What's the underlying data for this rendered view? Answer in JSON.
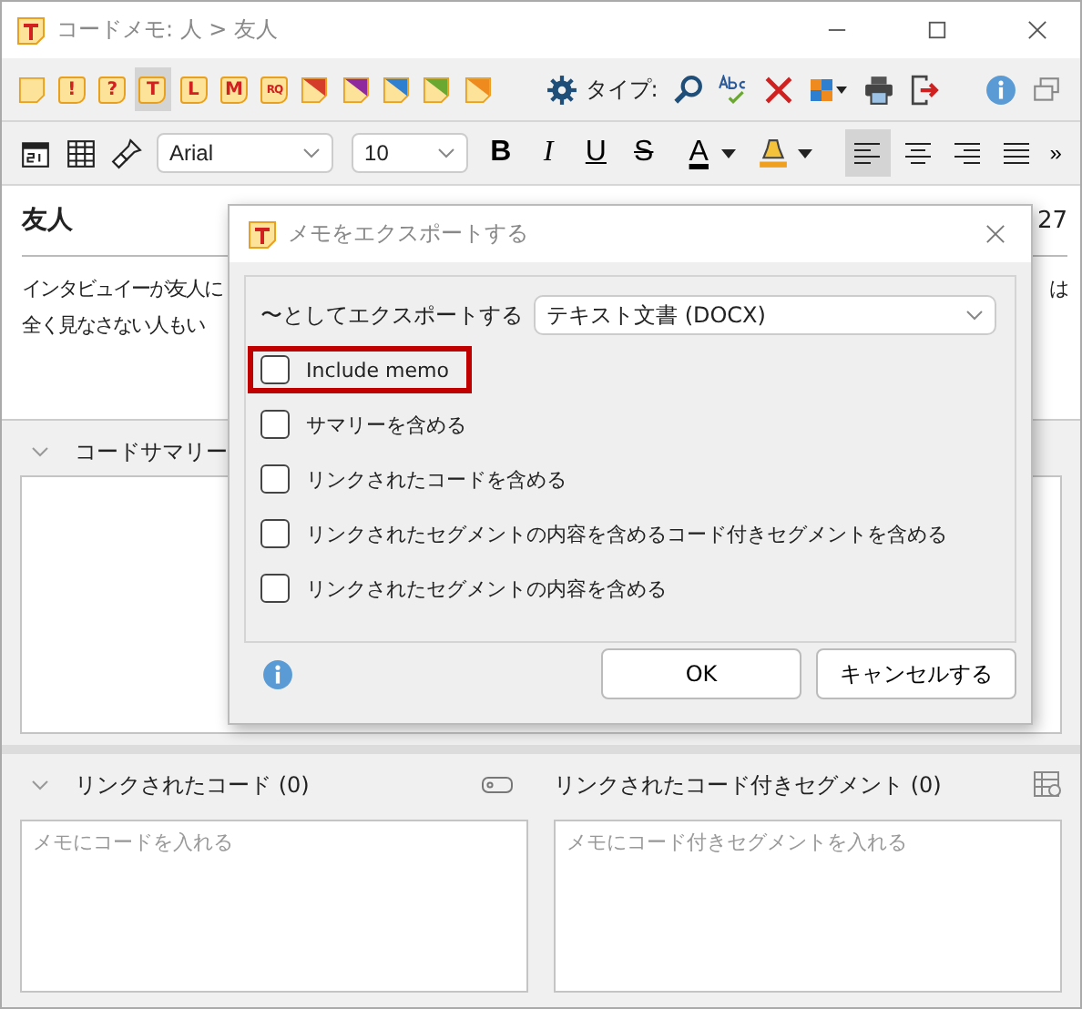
{
  "window": {
    "title": "コードメモ: 人 > 友人"
  },
  "memo_types": [
    {
      "kind": "blank",
      "selected": false
    },
    {
      "kind": "letter",
      "label": "!",
      "selected": false
    },
    {
      "kind": "letter",
      "label": "?",
      "selected": false
    },
    {
      "kind": "letter",
      "label": "T",
      "selected": true
    },
    {
      "kind": "letter",
      "label": "L",
      "selected": false
    },
    {
      "kind": "letter",
      "label": "M",
      "selected": false
    },
    {
      "kind": "letter",
      "label": "RQ",
      "selected": false
    },
    {
      "kind": "color",
      "color": "#d63c2a",
      "selected": false
    },
    {
      "kind": "color",
      "color": "#8e2a9e",
      "selected": false
    },
    {
      "kind": "color",
      "color": "#2f7fd0",
      "selected": false
    },
    {
      "kind": "color",
      "color": "#6aa832",
      "selected": false
    },
    {
      "kind": "color",
      "color": "#ef8a1e",
      "selected": false
    }
  ],
  "type_label": "タイプ:",
  "format_bar": {
    "font": "Arial",
    "size": "10",
    "styles": [
      {
        "kind": "bold",
        "label": "B"
      },
      {
        "kind": "italic",
        "label": "I"
      },
      {
        "kind": "underline",
        "label": "U"
      },
      {
        "kind": "strike",
        "label": "S"
      }
    ],
    "font_color_label": "A",
    "alignments": [
      {
        "kind": "left",
        "selected": true
      },
      {
        "kind": "center",
        "selected": false
      },
      {
        "kind": "right",
        "selected": false
      },
      {
        "kind": "justify",
        "selected": false
      }
    ],
    "overflow": "»"
  },
  "memo": {
    "title": "友人",
    "date": "27",
    "lines": [
      "インタビュイーが友人に",
      "全く見なさない人もい"
    ],
    "line_end": "は"
  },
  "summary": {
    "title": "コードサマリー"
  },
  "linked_codes": {
    "title": "リンクされたコード (0)",
    "placeholder": "メモにコードを入れる"
  },
  "linked_segments": {
    "title": "リンクされたコード付きセグメント (0)",
    "placeholder": "メモにコード付きセグメントを入れる"
  },
  "dialog": {
    "title": "メモをエクスポートする",
    "export_label": "〜としてエクスポートする",
    "format": "テキスト文書 (DOCX)",
    "options": [
      {
        "label": "Include memo",
        "checked": false,
        "highlighted": true
      },
      {
        "label": "サマリーを含める",
        "checked": false,
        "highlighted": false
      },
      {
        "label": "リンクされたコードを含める",
        "checked": false,
        "highlighted": false
      },
      {
        "label": "リンクされたセグメントの内容を含めるコード付きセグメントを含める",
        "checked": false,
        "highlighted": false
      },
      {
        "label": "リンクされたセグメントの内容を含める",
        "checked": false,
        "highlighted": false
      }
    ],
    "buttons": [
      "OK",
      "キャンセルする"
    ]
  }
}
